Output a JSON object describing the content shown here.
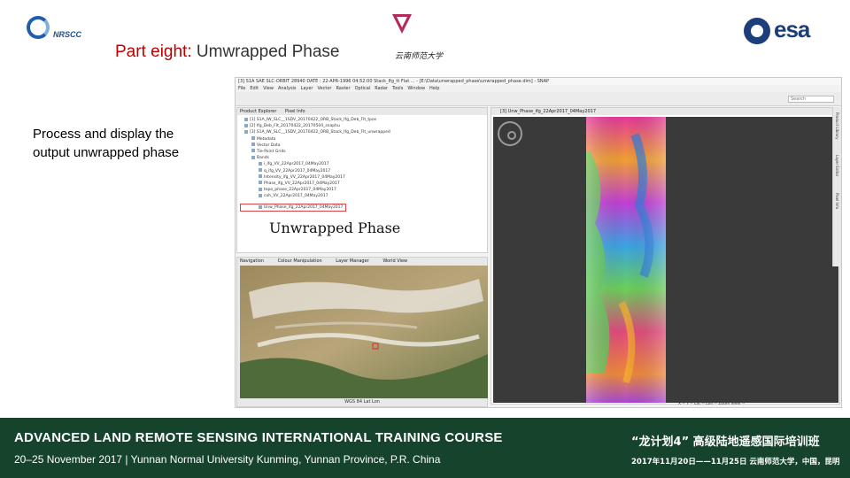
{
  "logos": {
    "left_text": "NRSCC",
    "left_icon": "nrscc-logo",
    "center_icon": "university-logo",
    "center_text": "云南师范大学",
    "right_text": "esa",
    "right_icon": "esa-logo"
  },
  "title": {
    "part": "Part eight:",
    "topic": "Umwrapped Phase"
  },
  "description": "Process and display the output unwrapped phase",
  "overlay_label": "Unwrapped Phase",
  "screenshot": {
    "window_title": "[3] S1A SAE SLC-ORBIT 28940 DATE : 22-APR-1996 04:52:00 Stack_Ifg_tt Flat ... - [E:\\Data\\unwrapped_phase\\unwrapped_phase.dim] - SNAP",
    "menu": [
      "File",
      "Edit",
      "View",
      "Analysis",
      "Layer",
      "Vector",
      "Raster",
      "Optical",
      "Radar",
      "Tools",
      "Window",
      "Help"
    ],
    "search_placeholder": "Search",
    "product_tabs": [
      "Product Explorer",
      "Pixel Info"
    ],
    "tree": [
      "[1] S1A_IW_SLC__1SDV_20170422_ORB_Stack_Ifg_Deb_Flt_tpos",
      "[2] Ifg_Deb_Flt_20170422_20170504_snaphu",
      "[3] S1A_IW_SLC__1SDV_20170422_ORB_Stack_Ifg_Deb_Flt_unwrapped",
      "Metadata",
      "Vector Data",
      "Tie-Point Grids",
      "Bands",
      "i_ifg_VV_22Apr2017_04May2017",
      "q_ifg_VV_22Apr2017_04May2017",
      "Intensity_ifg_VV_22Apr2017_04May2017",
      "Phase_ifg_VV_22Apr2017_04May2017",
      "topo_phase_22Apr2017_04May2017",
      "coh_VV_22Apr2017_04May2017",
      "Unw_Phase_ifg_22Apr2017_04May2017"
    ],
    "selected_index": 13,
    "world_tabs": [
      "Navigation",
      "Colour Manipulation",
      "Layer Manager",
      "World View"
    ],
    "world_status": "WGS 84 Lat Lon",
    "view_tab": "[3] Unw_Phase_ifg_22Apr2017_04May2017",
    "right_tools": [
      "Product Library",
      "Layer Editor",
      "Pixel Info"
    ],
    "statusbar": "X  --  Y  --  Lat  --  Lon  --  Zoom level  --"
  },
  "footer": {
    "en_line1": "ADVANCED LAND REMOTE SENSING INTERNATIONAL TRAINING COURSE",
    "en_line2": "20–25 November 2017 | Yunnan Normal University Kunming, Yunnan Province, P.R. China",
    "cn_line1": "“龙计划4” 高级陆地遥感国际培训班",
    "cn_line2": "2017年11月20日——11月25日  云南师范大学，中国，昆明",
    "bg_color": "#16432c"
  },
  "colors": {
    "title_red": "#c00000",
    "selection_red": "#d64545"
  }
}
